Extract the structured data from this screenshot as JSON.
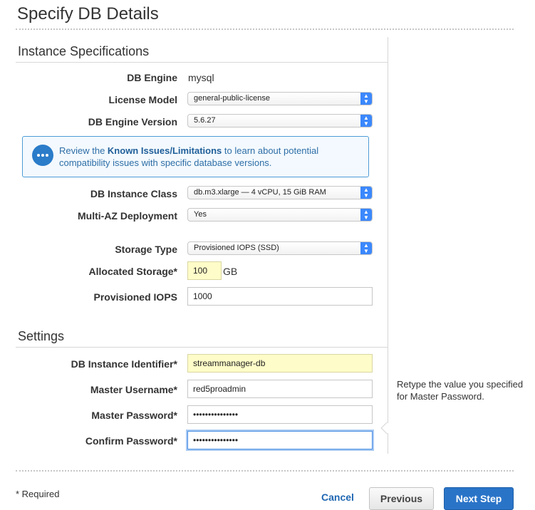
{
  "page": {
    "title": "Specify DB Details"
  },
  "instance_specs": {
    "title": "Instance Specifications",
    "db_engine": {
      "label": "DB Engine",
      "value": "mysql"
    },
    "license_model": {
      "label": "License Model",
      "value": "general-public-license"
    },
    "engine_version": {
      "label": "DB Engine Version",
      "value": "5.6.27"
    },
    "info": {
      "prefix": "Review the ",
      "link": "Known Issues/Limitations",
      "suffix": " to learn about potential compatibility issues with specific database versions."
    },
    "instance_class": {
      "label": "DB Instance Class",
      "value": "db.m3.xlarge — 4 vCPU, 15 GiB RAM"
    },
    "multi_az": {
      "label": "Multi-AZ Deployment",
      "value": "Yes"
    },
    "storage_type": {
      "label": "Storage Type",
      "value": "Provisioned IOPS (SSD)"
    },
    "allocated_storage": {
      "label": "Allocated Storage*",
      "value": "100",
      "unit": "GB"
    },
    "provisioned_iops": {
      "label": "Provisioned IOPS",
      "value": "1000"
    }
  },
  "settings": {
    "title": "Settings",
    "identifier": {
      "label": "DB Instance Identifier*",
      "value": "streammanager-db"
    },
    "master_username": {
      "label": "Master Username*",
      "value": "red5proadmin"
    },
    "master_password": {
      "label": "Master Password*",
      "value": "•••••••••••••••"
    },
    "confirm_password": {
      "label": "Confirm Password*",
      "value": "•••••••••••••••"
    },
    "help": "Retype the value you specified for Master Password."
  },
  "footer": {
    "required_note": "* Required",
    "cancel": "Cancel",
    "previous": "Previous",
    "next": "Next Step"
  },
  "colors": {
    "primary": "#2a74c8",
    "link": "#1f67b2",
    "select_arrow": "#3b88fd",
    "highlight_input": "#fefcc8"
  }
}
